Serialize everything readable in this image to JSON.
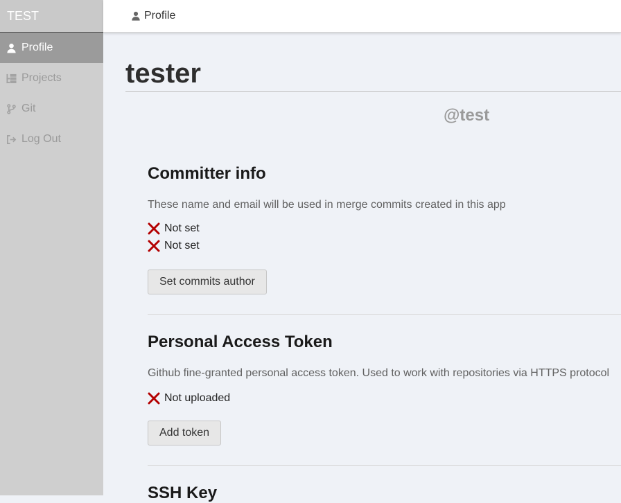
{
  "app": {
    "brand": "TEST"
  },
  "sidebar": {
    "items": [
      {
        "label": "Profile",
        "icon": "user-icon",
        "active": true
      },
      {
        "label": "Projects",
        "icon": "projects-icon",
        "active": false
      },
      {
        "label": "Git",
        "icon": "git-branch-icon",
        "active": false
      },
      {
        "label": "Log Out",
        "icon": "logout-icon",
        "active": false
      }
    ]
  },
  "topbar": {
    "breadcrumb": "Profile",
    "icon": "user-icon"
  },
  "profile": {
    "name": "tester",
    "handle": "@test"
  },
  "committer": {
    "title": "Committer info",
    "description": "These name and email will be used in merge commits created in this app",
    "name_status": "Not set",
    "email_status": "Not set",
    "button": "Set commits author"
  },
  "token": {
    "title": "Personal Access Token",
    "description": "Github fine-granted personal access token. Used to work with repositories via HTTPS protocol",
    "status": "Not uploaded",
    "button": "Add token"
  },
  "ssh": {
    "title": "SSH Key"
  },
  "colors": {
    "error_x": "#b30000",
    "sidebar_active": "#9b9b9b",
    "page_bg": "#eff2f7"
  }
}
